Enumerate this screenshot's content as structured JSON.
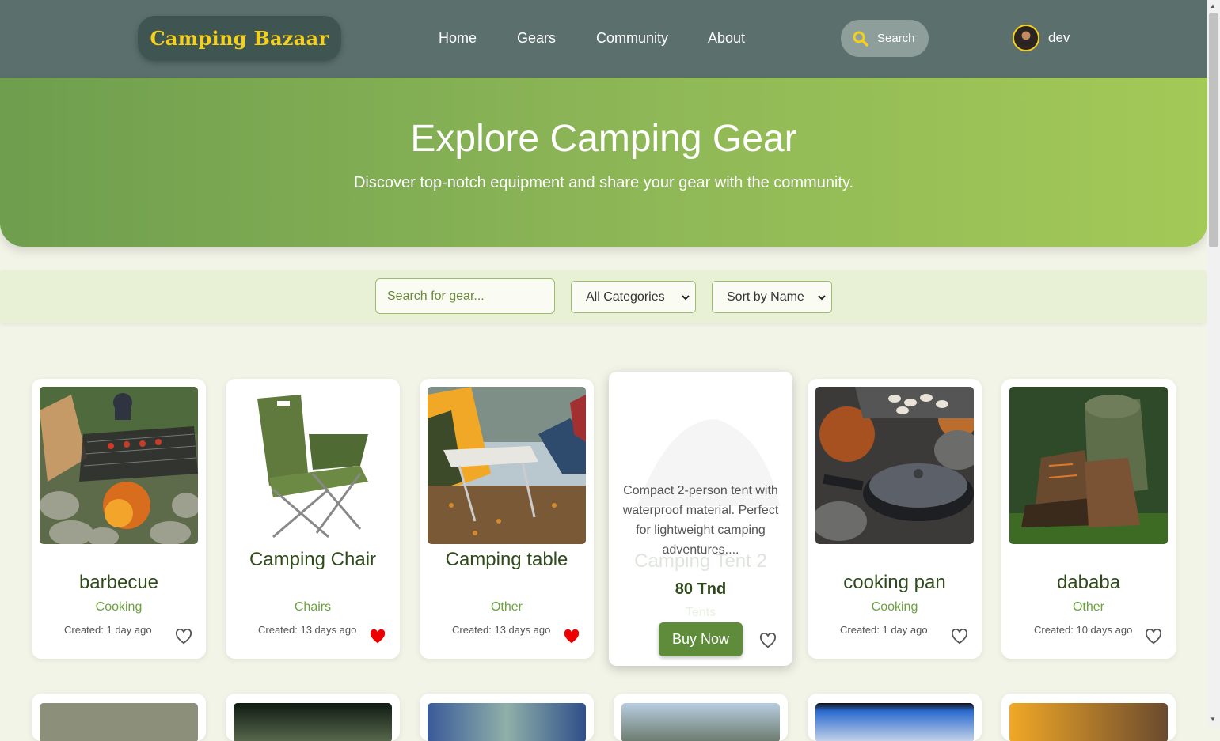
{
  "navbar": {
    "logo": "Camping Bazaar",
    "links": [
      "Home",
      "Gears",
      "Community",
      "About"
    ],
    "search_label": "Search",
    "username": "dev"
  },
  "hero": {
    "title": "Explore Camping Gear",
    "subtitle": "Discover top-notch equipment and share your gear with the community."
  },
  "filters": {
    "search_placeholder": "Search for gear...",
    "category_selected": "All Categories",
    "sort_selected": "Sort by Name"
  },
  "cards": [
    {
      "name": "barbecue",
      "category": "Cooking",
      "created": "Created: 1 day ago",
      "favorite": false
    },
    {
      "name": "Camping Chair",
      "category": "Chairs",
      "created": "Created: 13 days ago",
      "favorite": true
    },
    {
      "name": "Camping table",
      "category": "Other",
      "created": "Created: 13 days ago",
      "favorite": true
    },
    {
      "name": "Camping Tent 2",
      "category": "Tents",
      "description": "Compact 2-person tent with waterproof material. Perfect for lightweight camping adventures....",
      "price": "80 Tnd",
      "buy_label": "Buy Now",
      "favorite": false
    },
    {
      "name": "cooking pan",
      "category": "Cooking",
      "created": "Created: 1 day ago",
      "favorite": false
    },
    {
      "name": "dababa",
      "category": "Other",
      "created": "Created: 10 days ago",
      "favorite": false
    }
  ],
  "colors": {
    "navbar": "#5b706c",
    "logo_bg": "#3f5552",
    "logo_text": "#f4cf1c",
    "hero_start": "#6e9e4e",
    "hero_end": "#a3c957",
    "accent_green": "#6aa33c",
    "buy_button": "#5e8c3a",
    "heart_active": "#ee0000"
  }
}
